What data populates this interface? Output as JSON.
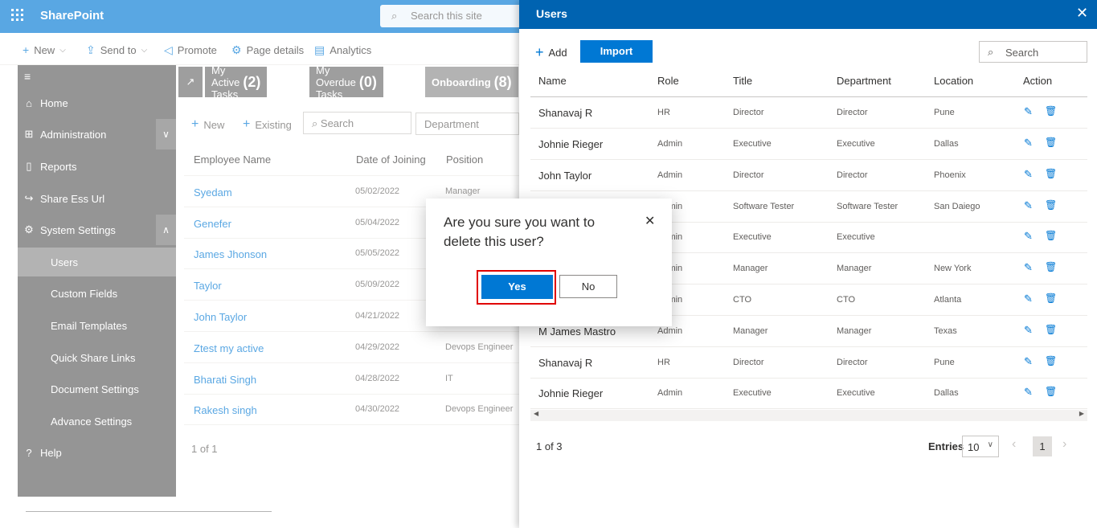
{
  "suite": {
    "app_name": "SharePoint",
    "search_placeholder": "Search this site"
  },
  "commandbar": {
    "new": "New",
    "send_to": "Send to",
    "promote": "Promote",
    "page_details": "Page details",
    "analytics": "Analytics"
  },
  "nav": {
    "items": [
      {
        "label": "Home",
        "icon": "home-icon"
      },
      {
        "label": "Administration",
        "icon": "admin-icon"
      },
      {
        "label": "Reports",
        "icon": "document-icon"
      },
      {
        "label": "Share Ess Url",
        "icon": "share-icon"
      },
      {
        "label": "System Settings",
        "icon": "gear-icon"
      },
      {
        "label": "Users"
      },
      {
        "label": "Custom Fields"
      },
      {
        "label": "Email Templates"
      },
      {
        "label": "Quick Share Links"
      },
      {
        "label": "Document Settings"
      },
      {
        "label": "Advance Settings"
      },
      {
        "label": "Help",
        "icon": "help-icon"
      }
    ]
  },
  "tabs": [
    {
      "label": "My Active Tasks",
      "count": "(2)"
    },
    {
      "label": "My Overdue Tasks",
      "count": "(0)"
    },
    {
      "label": "Onboarding",
      "count": "(8)"
    }
  ],
  "employees": {
    "new": "New",
    "existing": "Existing",
    "search_placeholder": "Search",
    "department_placeholder": "Department",
    "headers": [
      "Employee Name",
      "Date of Joining",
      "Position"
    ],
    "rows": [
      {
        "name": "Syedam",
        "date": "05/02/2022",
        "position": "Manager"
      },
      {
        "name": "Genefer",
        "date": "05/04/2022",
        "position": ""
      },
      {
        "name": "James Jhonson",
        "date": "05/05/2022",
        "position": ""
      },
      {
        "name": "Taylor",
        "date": "05/09/2022",
        "position": ""
      },
      {
        "name": "John Taylor",
        "date": "04/21/2022",
        "position": ""
      },
      {
        "name": "Ztest my active",
        "date": "04/29/2022",
        "position": "Devops Engineer"
      },
      {
        "name": "Bharati Singh",
        "date": "04/28/2022",
        "position": "IT"
      },
      {
        "name": "Rakesh singh",
        "date": "04/30/2022",
        "position": "Devops Engineer"
      }
    ],
    "pager": "1 of 1"
  },
  "panel": {
    "title": "Users",
    "add": "Add",
    "import": "Import",
    "search": "Search",
    "headers": [
      "Name",
      "Role",
      "Title",
      "Department",
      "Location",
      "Action"
    ],
    "rows": [
      {
        "name": "Shanavaj R",
        "role": "HR",
        "title": "Director",
        "dept": "Director",
        "loc": "Pune"
      },
      {
        "name": "Johnie Rieger",
        "role": "Admin",
        "title": "Executive",
        "dept": "Executive",
        "loc": "Dallas"
      },
      {
        "name": "John Taylor",
        "role": "Admin",
        "title": "Director",
        "dept": "Director",
        "loc": "Phoenix"
      },
      {
        "name": "",
        "role": "Admin",
        "title": "Software Tester",
        "dept": "Software Tester",
        "loc": "San Daiego"
      },
      {
        "name": "",
        "role": "Admin",
        "title": "Executive",
        "dept": "Executive",
        "loc": ""
      },
      {
        "name": "",
        "role": "Admin",
        "title": "Manager",
        "dept": "Manager",
        "loc": "New York"
      },
      {
        "name": "",
        "role": "Admin",
        "title": "CTO",
        "dept": "CTO",
        "loc": "Atlanta"
      },
      {
        "name": "M James Mastro",
        "role": "Admin",
        "title": "Manager",
        "dept": "Manager",
        "loc": "Texas"
      },
      {
        "name": "Shanavaj R",
        "role": "HR",
        "title": "Director",
        "dept": "Director",
        "loc": "Pune"
      },
      {
        "name": "Johnie Rieger",
        "role": "Admin",
        "title": "Executive",
        "dept": "Executive",
        "loc": "Dallas"
      }
    ],
    "pager": "1 of 3",
    "entries_label": "Entries",
    "entries_value": "10",
    "page": "1"
  },
  "modal": {
    "message": "Are you sure you want to delete this user?",
    "yes": "Yes",
    "no": "No"
  }
}
